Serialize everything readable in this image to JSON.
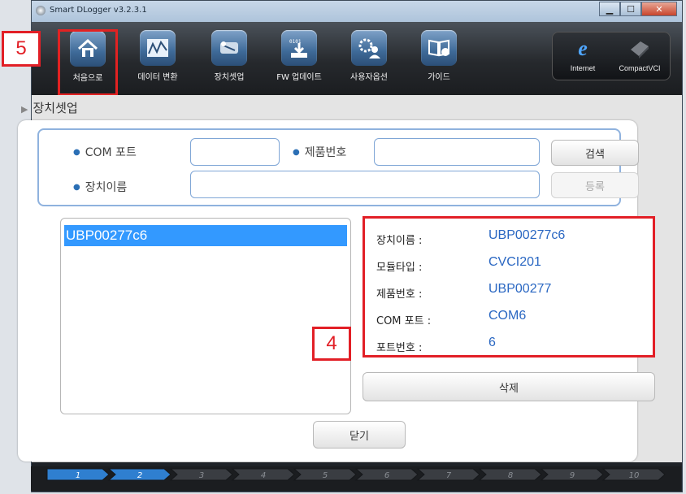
{
  "window": {
    "title": "Smart DLogger v3.2.3.1"
  },
  "toolbar": {
    "items": [
      {
        "label": "처음으로",
        "icon": "home-icon"
      },
      {
        "label": "데이터 변환",
        "icon": "chart-convert-icon"
      },
      {
        "label": "장치셋업",
        "icon": "device-setup-icon"
      },
      {
        "label": "FW 업데이트",
        "icon": "firmware-update-icon"
      },
      {
        "label": "사용자옵션",
        "icon": "user-options-icon"
      },
      {
        "label": "가이드",
        "icon": "guide-book-icon"
      }
    ],
    "right_items": [
      {
        "label": "Internet",
        "icon": "internet-explorer-icon"
      },
      {
        "label": "CompactVCI",
        "icon": "compactvci-device-icon"
      }
    ]
  },
  "section": {
    "title": "장치셋업"
  },
  "search": {
    "com_port_label": "COM 포트",
    "com_port_value": "",
    "product_no_label": "제품번호",
    "product_no_value": "",
    "device_name_label": "장치이름",
    "device_name_value": "",
    "search_button": "검색",
    "register_button": "등록"
  },
  "device_list": [
    "UBP00277c6"
  ],
  "details": {
    "rows": [
      {
        "label": "장치이름 :",
        "value": "UBP00277c6"
      },
      {
        "label": "모듈타입 :",
        "value": "CVCI201"
      },
      {
        "label": "제품번호 :",
        "value": "UBP00277"
      },
      {
        "label": "COM 포트 :",
        "value": "COM6"
      },
      {
        "label": "포트번호 :",
        "value": "6"
      }
    ]
  },
  "buttons": {
    "delete": "삭제",
    "close": "닫기"
  },
  "annotations": {
    "badge_4": "4",
    "badge_5": "5"
  },
  "steps": [
    "1",
    "2",
    "3",
    "4",
    "5",
    "6",
    "7",
    "8",
    "9",
    "10"
  ],
  "steps_active_count": 2,
  "colors": {
    "accent_blue": "#2a67c2",
    "highlight_red": "#e21f26",
    "selected_row": "#3399ff"
  }
}
